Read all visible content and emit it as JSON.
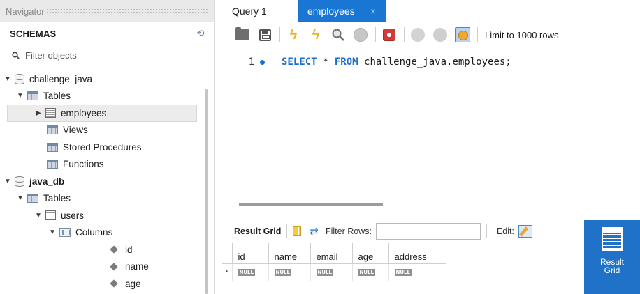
{
  "navigator": {
    "header": "Navigator",
    "schemas_title": "SCHEMAS",
    "filter_placeholder": "Filter objects",
    "tree": {
      "db1": {
        "name": "challenge_java",
        "tables": "Tables",
        "table": "employees",
        "views": "Views",
        "procs": "Stored Procedures",
        "funcs": "Functions"
      },
      "db2": {
        "name": "java_db",
        "tables": "Tables",
        "table": "users",
        "columns": "Columns",
        "cols": [
          "id",
          "name",
          "age"
        ]
      }
    }
  },
  "tabs": [
    {
      "label": "Query 1"
    },
    {
      "label": "employees",
      "close": "×"
    }
  ],
  "toolbar": {
    "limit": "Limit to 1000 rows"
  },
  "editor": {
    "line_number": "1",
    "kw_select": "SELECT",
    "star": " * ",
    "kw_from": "FROM",
    "rest": " challenge_java.employees;"
  },
  "result": {
    "title": "Result Grid",
    "filter_label": "Filter Rows:",
    "edit_label": "Edit:",
    "columns": [
      "id",
      "name",
      "email",
      "age",
      "address"
    ],
    "row_marker": "*",
    "null_label": "NULL",
    "side_button": {
      "line1": "Result",
      "line2": "Grid"
    }
  }
}
